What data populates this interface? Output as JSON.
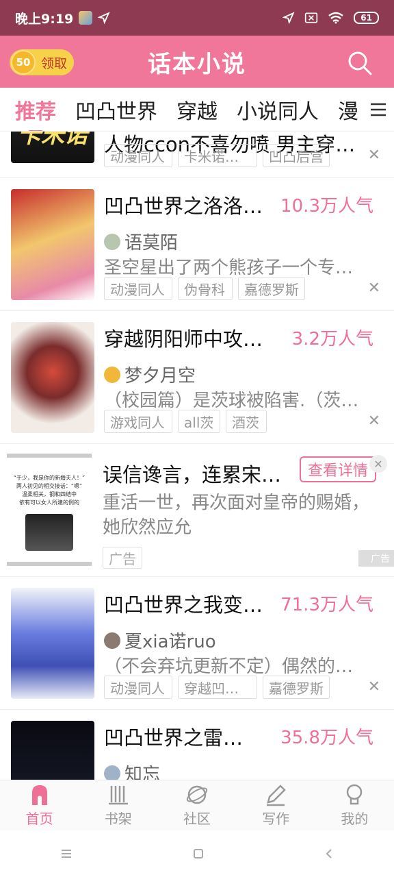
{
  "status": {
    "time": "晚上9:19",
    "battery": "61"
  },
  "header": {
    "title": "话本小说",
    "reward_amount": "50",
    "reward_label": "领取"
  },
  "tabs": [
    {
      "label": "推荐"
    },
    {
      "label": "凹凸世界"
    },
    {
      "label": "穿越"
    },
    {
      "label": "小说同人"
    },
    {
      "label": "漫"
    }
  ],
  "feed": {
    "item0": {
      "title": "人物ccon不喜勿喷 男主穿越…",
      "tags": [
        "动漫同人",
        "卡米诺…",
        "凹凸后宫"
      ],
      "cover_text": "卡米诺"
    },
    "item1": {
      "title": "凹凸世界之洛洛…",
      "popularity": "10.3万人气",
      "author": "语莫陌",
      "summary": "圣空星出了两个熊孩子一个专…",
      "tags": [
        "动漫同人",
        "伪骨科",
        "嘉德罗斯"
      ]
    },
    "item2": {
      "title": "穿越阴阳师中攻…",
      "popularity": "3.2万人气",
      "author": "梦夕月空",
      "summary": "（校园篇）是茨球被陷害.（茨…",
      "tags": [
        "游戏同人",
        "all茨",
        "酒茨"
      ]
    },
    "ad": {
      "title": "误信谗言，连累宋…",
      "button": "查看详情",
      "desc": "重活一世，再次面对皇帝的赐婚，她欣然应允",
      "tag": "广告",
      "mark": "广告",
      "cover_line1": "“于少，我是你的新婚夫人！”",
      "cover_line2": "两人初见的相交接话：“嗯”",
      "cover_line3": "温柔相关，钢和四结中",
      "cover_line4": "依有可以女人所建的例的"
    },
    "item3": {
      "title": "凹凸世界之我变…",
      "popularity": "71.3万人气",
      "author": "夏xia诺ruo",
      "summary": "（不会弃坑更新不定）偶然的…",
      "tags": [
        "动漫同人",
        "穿越凹…",
        "嘉德罗斯"
      ]
    },
    "item4": {
      "title": "凹凸世界之雷…",
      "popularity": "35.8万人气",
      "author": "知忘"
    }
  },
  "bottom_nav": [
    {
      "label": "首页"
    },
    {
      "label": "书架"
    },
    {
      "label": "社区"
    },
    {
      "label": "写作"
    },
    {
      "label": "我的"
    }
  ],
  "colors": {
    "accent": "#f0779a",
    "status_bar": "#8e3a52"
  }
}
